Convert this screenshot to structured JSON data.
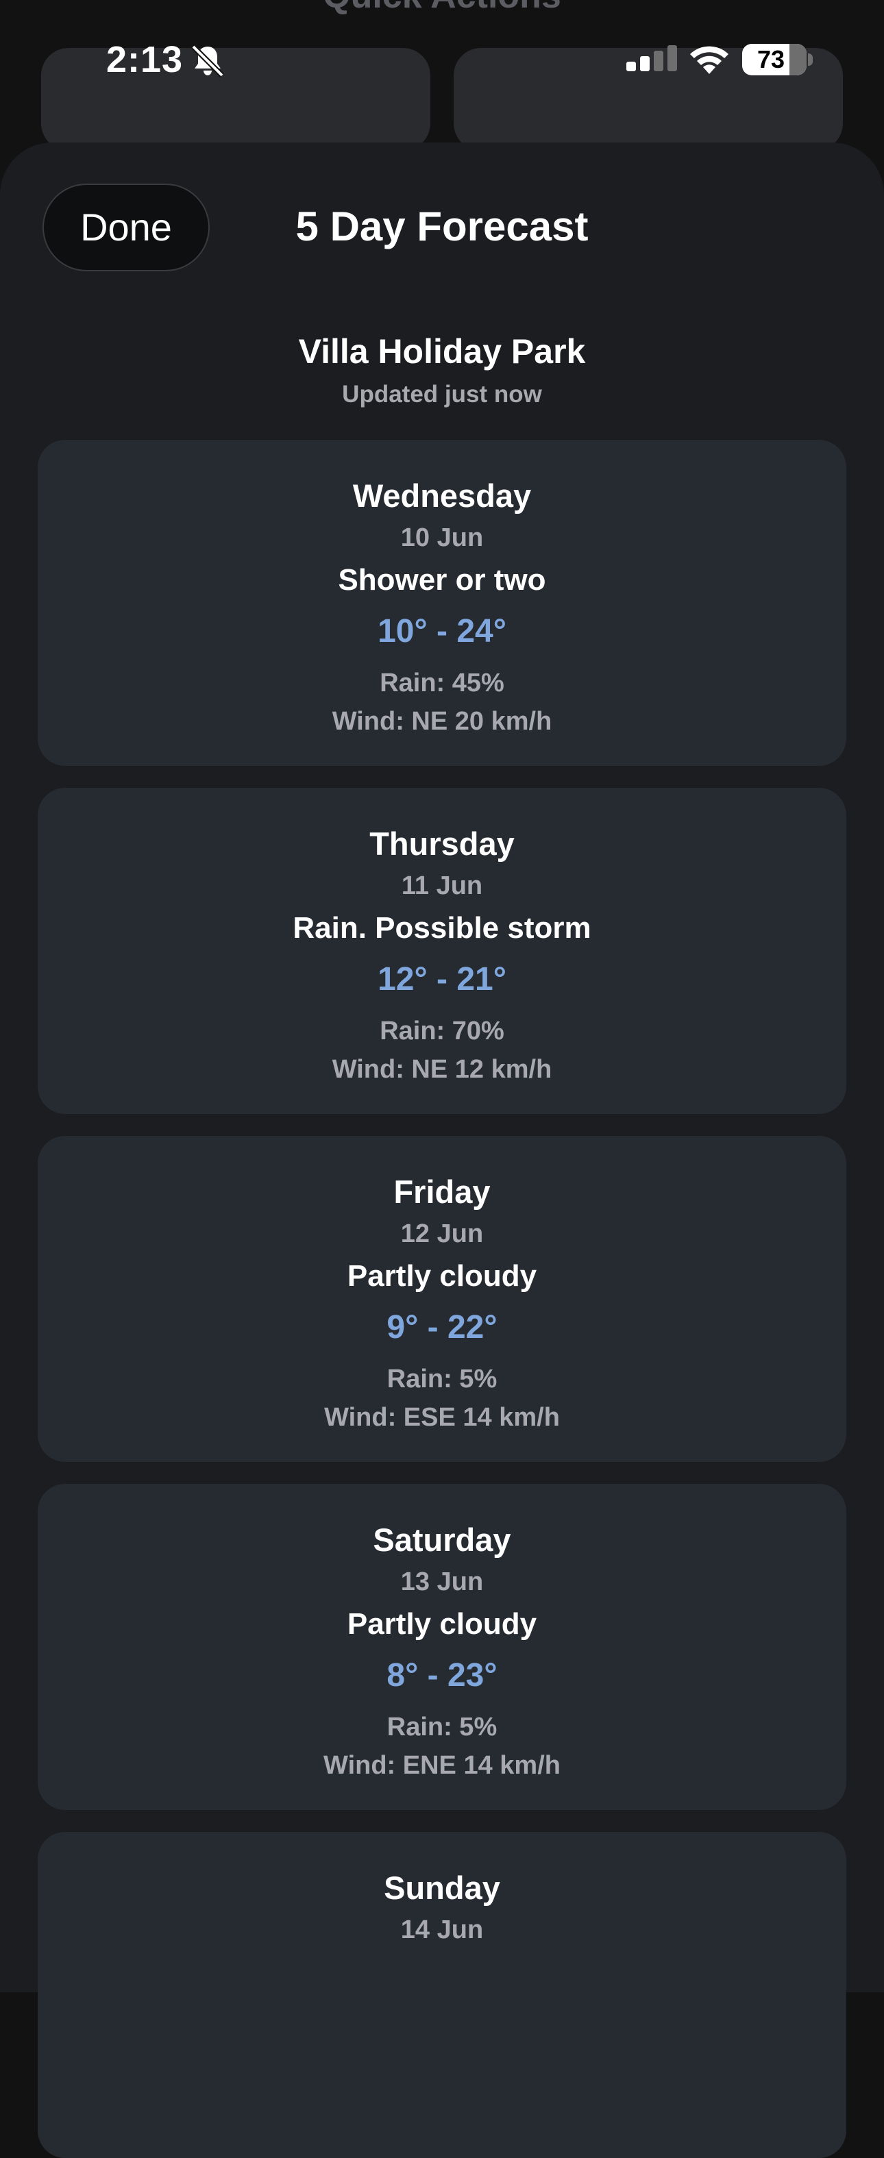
{
  "background": {
    "title": "Quick Actions"
  },
  "status_bar": {
    "time": "2:13",
    "battery": "73",
    "battery_level": 0.73
  },
  "sheet": {
    "done_label": "Done",
    "title": "5 Day Forecast",
    "location": "Villa Holiday Park",
    "updated": "Updated just now"
  },
  "days": [
    {
      "day": "Wednesday",
      "date": "10 Jun",
      "condition": "Shower or two",
      "temp": "10° - 24°",
      "rain": "Rain: 45%",
      "wind": "Wind: NE 20 km/h"
    },
    {
      "day": "Thursday",
      "date": "11 Jun",
      "condition": "Rain. Possible storm",
      "temp": "12° - 21°",
      "rain": "Rain: 70%",
      "wind": "Wind: NE 12 km/h"
    },
    {
      "day": "Friday",
      "date": "12 Jun",
      "condition": "Partly cloudy",
      "temp": "9° - 22°",
      "rain": "Rain: 5%",
      "wind": "Wind: ESE 14 km/h"
    },
    {
      "day": "Saturday",
      "date": "13 Jun",
      "condition": "Partly cloudy",
      "temp": "8° - 23°",
      "rain": "Rain: 5%",
      "wind": "Wind: ENE 14 km/h"
    },
    {
      "day": "Sunday",
      "date": "14 Jun"
    }
  ],
  "colors": {
    "temp_accent": "#7fa7dd",
    "card_bg": "#262a31",
    "sheet_bg": "#1b1d21"
  }
}
